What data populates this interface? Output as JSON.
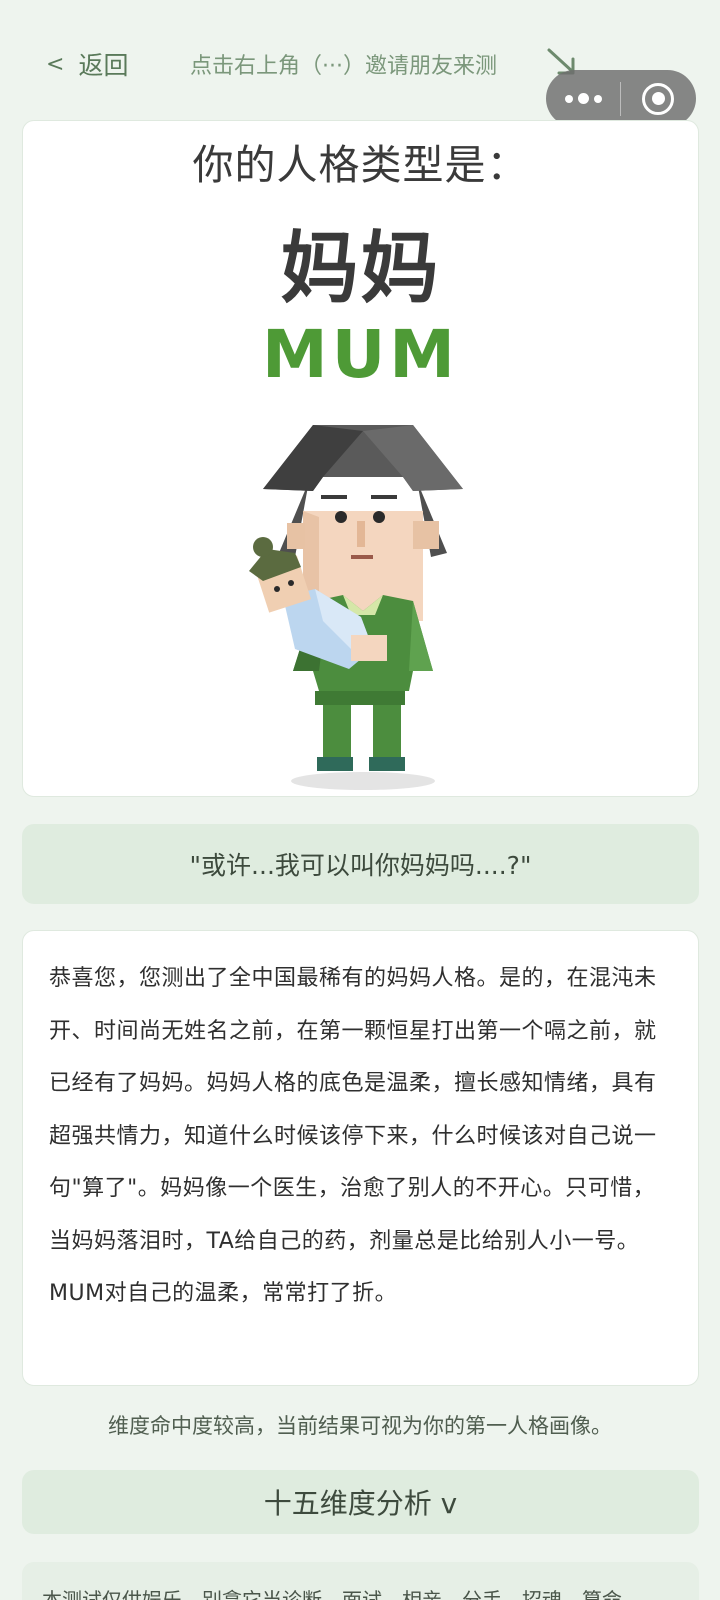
{
  "nav": {
    "back_chevron": "<",
    "back_label": "返回",
    "share_hint": "点击右上角（···）邀请朋友来测",
    "hint_icon": "arrow-down-right-icon",
    "capsule_icons": [
      "more-dots-icon",
      "close-target-icon"
    ]
  },
  "result": {
    "title": "你的人格类型是：",
    "type_name": "妈妈",
    "type_en": "MUM",
    "accent_color": "#4e9a36"
  },
  "quote": "\"或许...我可以叫你妈妈吗....?\"",
  "description": "恭喜您，您测出了全中国最稀有的妈妈人格。是的，在混沌未开、时间尚无姓名之前，在第一颗恒星打出第一个嗝之前，就已经有了妈妈。妈妈人格的底色是温柔，擅长感知情绪，具有超强共情力，知道什么时候该停下来，什么时候该对自己说一句\"算了\"。妈妈像一个医生，治愈了别人的不开心。只可惜，当妈妈落泪时，TA给自己的药，剂量总是比给别人小一号。MUM对自己的温柔，常常打了折。",
  "confidence_note": "维度命中度较高，当前结果可视为你的第一人格画像。",
  "analysis_button": "十五维度分析 v",
  "disclaimer": "本测试仅供娱乐，别拿它当诊断、面试、相亲、分手、招魂、算命"
}
